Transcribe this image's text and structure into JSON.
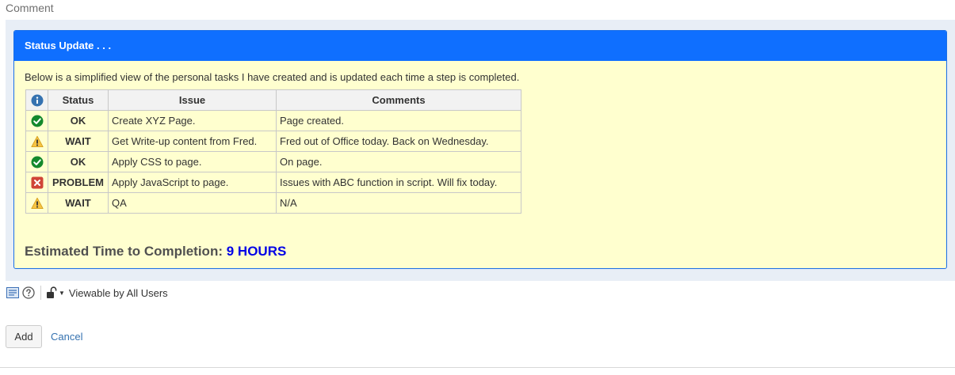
{
  "comment_label": "Comment",
  "panel": {
    "title": "Status Update . . .",
    "intro": "Below is a simplified view of the personal tasks I have created and is updated each time a step is completed.",
    "table": {
      "headers": {
        "icon": "info-icon",
        "status": "Status",
        "issue": "Issue",
        "comments": "Comments"
      },
      "rows": [
        {
          "icon": "check-circle-icon",
          "status": "OK",
          "status_kind": "ok",
          "issue": "Create XYZ Page.",
          "comments": "Page created."
        },
        {
          "icon": "warning-icon",
          "status": "WAIT",
          "status_kind": "wait",
          "issue": "Get Write-up content from Fred.",
          "comments": "Fred out of Office today. Back on Wednesday."
        },
        {
          "icon": "check-circle-icon",
          "status": "OK",
          "status_kind": "ok",
          "issue": "Apply CSS to page.",
          "comments": "On page."
        },
        {
          "icon": "error-icon",
          "status": "PROBLEM",
          "status_kind": "problem",
          "issue": "Apply JavaScript to page.",
          "comments": "Issues with ABC function in script. Will fix today."
        },
        {
          "icon": "warning-icon",
          "status": "WAIT",
          "status_kind": "wait",
          "issue": "QA",
          "comments": "N/A"
        }
      ]
    },
    "estimate_label": "Estimated Time to Completion:",
    "estimate_value": "9 HOURS"
  },
  "toolbar": {
    "editor_mode_icon": "text-mode-icon",
    "help_icon": "help-icon",
    "lock_icon": "unlock-icon",
    "visibility_label": "Viewable by All Users"
  },
  "actions": {
    "add_label": "Add",
    "cancel_label": "Cancel"
  },
  "colors": {
    "panel_header": "#0f6fff",
    "panel_body": "#ffffcf",
    "ok": "#14892c",
    "wait": "#f6a01a",
    "problem": "#d04437",
    "estimate_value": "#0000e6",
    "link": "#3572b0"
  }
}
